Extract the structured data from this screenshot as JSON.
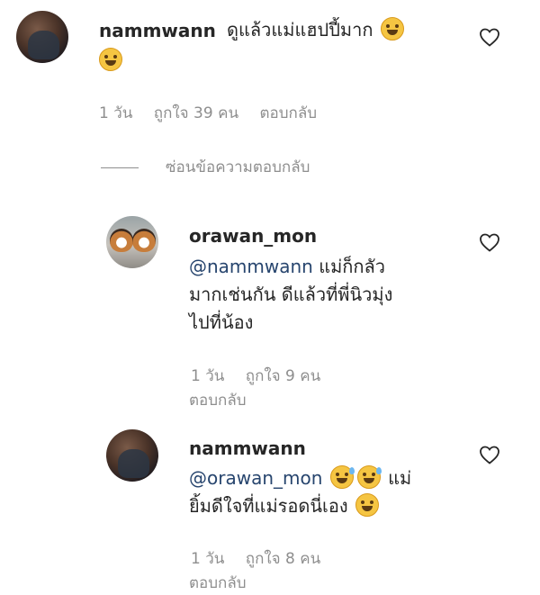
{
  "comments": [
    {
      "username": "nammwann",
      "text": "ดูแล้วแม่แฮปปี้มาก",
      "emojis": [
        "rofl-emoji",
        "rofl-emoji"
      ],
      "time": "1 วัน",
      "likes": "ถูกใจ 39 คน",
      "reply": "ตอบกลับ"
    }
  ],
  "hide_replies": "ซ่อนข้อความตอบกลับ",
  "replies": [
    {
      "username": "orawan_mon",
      "mention": "@nammwann",
      "text_line1": "แม่ก็กลัว",
      "text_line2": "มากเช่นกัน ดีแล้วที่พี่นิวมุ่ง",
      "text_line3": "ไปที่น้อง",
      "time": "1 วัน",
      "likes": "ถูกใจ 9 คน",
      "reply": "ตอบกลับ"
    },
    {
      "username": "nammwann",
      "mention": "@orawan_mon",
      "text_line1": "แม่",
      "text_line2": "ยิ้มดีใจที่แม่รอดนี่เอง",
      "emojis": [
        "grinning-sweat-emoji",
        "grinning-sweat-emoji",
        "laughing-emoji"
      ],
      "time": "1 วัน",
      "likes": "ถูกใจ 8 คน",
      "reply": "ตอบกลับ"
    }
  ],
  "icons": {
    "like": "heart-outline-icon"
  }
}
